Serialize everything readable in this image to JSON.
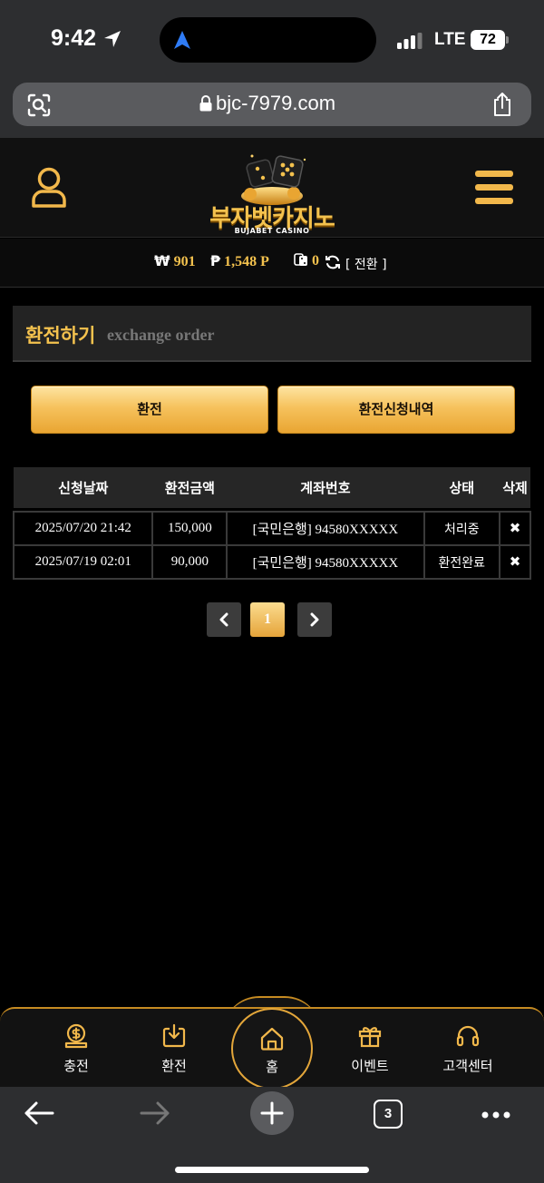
{
  "status_bar": {
    "time": "9:42",
    "network": "LTE",
    "battery": "72"
  },
  "browser": {
    "url": "bjc-7979.com",
    "tab_count": "3"
  },
  "header": {
    "logo_text": "부자벳카지노",
    "logo_subtitle": "BUJABET CASINO",
    "accent_color": "#f4c24e"
  },
  "balance": {
    "won_symbol": "₩",
    "won_value": "901",
    "point_symbol": "₱",
    "point_value": "1,548 P",
    "chip_value": "0",
    "convert_label": "[ 전환 ]"
  },
  "page_title": {
    "korean": "환전하기",
    "english": "exchange order"
  },
  "actions": {
    "exchange_label": "환전",
    "history_label": "환전신청내역"
  },
  "table": {
    "headers": [
      "신청날짜",
      "환전금액",
      "계좌번호",
      "상태",
      "삭제"
    ],
    "rows": [
      {
        "date": "2025/07/20 21:42",
        "amount": "150,000",
        "account": "[국민은행] 94580XXXXX",
        "status": "처리중",
        "delete": "✖"
      },
      {
        "date": "2025/07/19 02:01",
        "amount": "90,000",
        "account": "[국민은행] 94580XXXXX",
        "status": "환전완료",
        "delete": "✖"
      }
    ]
  },
  "pagination": {
    "current": "1"
  },
  "bottom_nav": {
    "items": [
      {
        "label": "충전",
        "icon": "coin-dollar-icon"
      },
      {
        "label": "환전",
        "icon": "download-tray-icon"
      },
      {
        "label": "홈",
        "icon": "home-icon"
      },
      {
        "label": "이벤트",
        "icon": "gift-icon"
      },
      {
        "label": "고객센터",
        "icon": "headset-icon"
      }
    ]
  }
}
